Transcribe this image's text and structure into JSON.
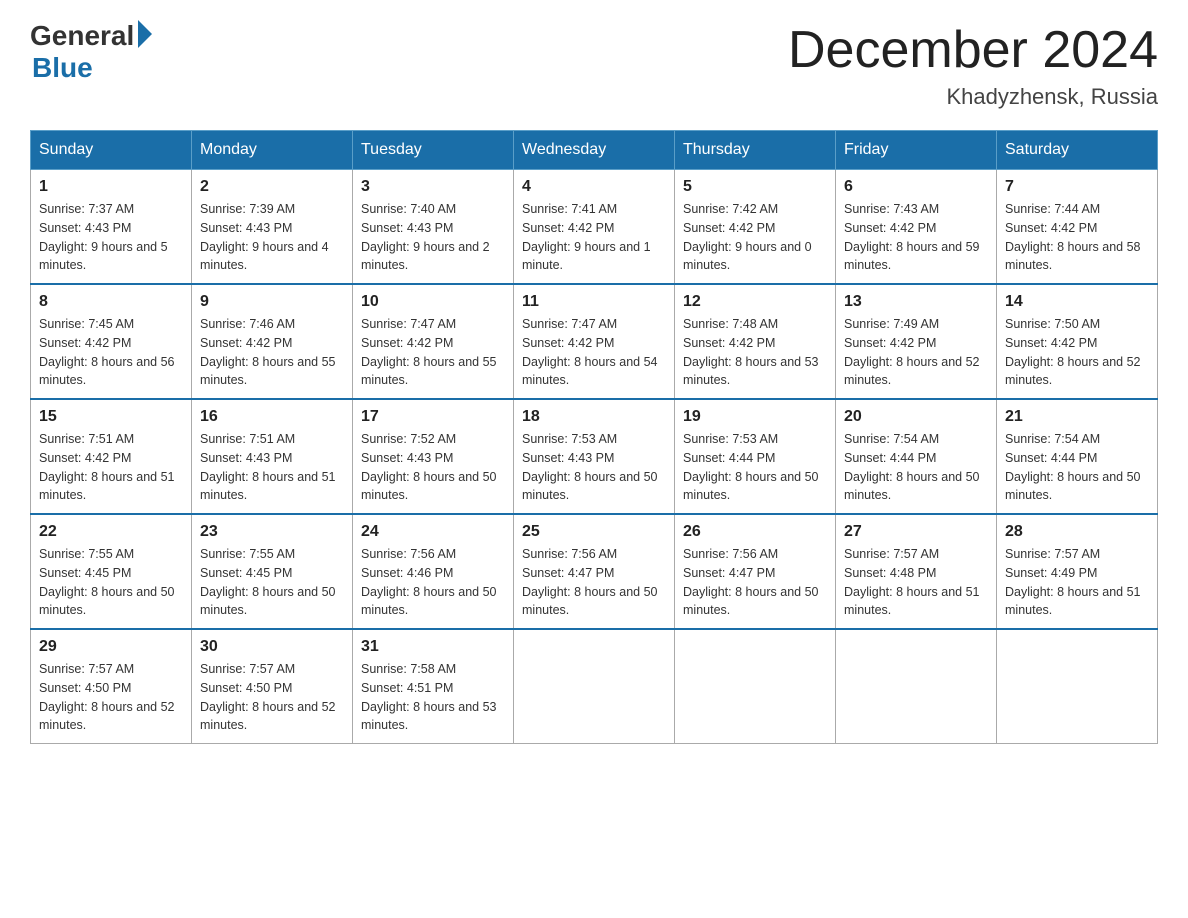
{
  "header": {
    "logo_general": "General",
    "logo_blue": "Blue",
    "title": "December 2024",
    "location": "Khadyzhensk, Russia"
  },
  "weekdays": [
    "Sunday",
    "Monday",
    "Tuesday",
    "Wednesday",
    "Thursday",
    "Friday",
    "Saturday"
  ],
  "weeks": [
    [
      {
        "day": "1",
        "sunrise": "7:37 AM",
        "sunset": "4:43 PM",
        "daylight": "9 hours and 5 minutes."
      },
      {
        "day": "2",
        "sunrise": "7:39 AM",
        "sunset": "4:43 PM",
        "daylight": "9 hours and 4 minutes."
      },
      {
        "day": "3",
        "sunrise": "7:40 AM",
        "sunset": "4:43 PM",
        "daylight": "9 hours and 2 minutes."
      },
      {
        "day": "4",
        "sunrise": "7:41 AM",
        "sunset": "4:42 PM",
        "daylight": "9 hours and 1 minute."
      },
      {
        "day": "5",
        "sunrise": "7:42 AM",
        "sunset": "4:42 PM",
        "daylight": "9 hours and 0 minutes."
      },
      {
        "day": "6",
        "sunrise": "7:43 AM",
        "sunset": "4:42 PM",
        "daylight": "8 hours and 59 minutes."
      },
      {
        "day": "7",
        "sunrise": "7:44 AM",
        "sunset": "4:42 PM",
        "daylight": "8 hours and 58 minutes."
      }
    ],
    [
      {
        "day": "8",
        "sunrise": "7:45 AM",
        "sunset": "4:42 PM",
        "daylight": "8 hours and 56 minutes."
      },
      {
        "day": "9",
        "sunrise": "7:46 AM",
        "sunset": "4:42 PM",
        "daylight": "8 hours and 55 minutes."
      },
      {
        "day": "10",
        "sunrise": "7:47 AM",
        "sunset": "4:42 PM",
        "daylight": "8 hours and 55 minutes."
      },
      {
        "day": "11",
        "sunrise": "7:47 AM",
        "sunset": "4:42 PM",
        "daylight": "8 hours and 54 minutes."
      },
      {
        "day": "12",
        "sunrise": "7:48 AM",
        "sunset": "4:42 PM",
        "daylight": "8 hours and 53 minutes."
      },
      {
        "day": "13",
        "sunrise": "7:49 AM",
        "sunset": "4:42 PM",
        "daylight": "8 hours and 52 minutes."
      },
      {
        "day": "14",
        "sunrise": "7:50 AM",
        "sunset": "4:42 PM",
        "daylight": "8 hours and 52 minutes."
      }
    ],
    [
      {
        "day": "15",
        "sunrise": "7:51 AM",
        "sunset": "4:42 PM",
        "daylight": "8 hours and 51 minutes."
      },
      {
        "day": "16",
        "sunrise": "7:51 AM",
        "sunset": "4:43 PM",
        "daylight": "8 hours and 51 minutes."
      },
      {
        "day": "17",
        "sunrise": "7:52 AM",
        "sunset": "4:43 PM",
        "daylight": "8 hours and 50 minutes."
      },
      {
        "day": "18",
        "sunrise": "7:53 AM",
        "sunset": "4:43 PM",
        "daylight": "8 hours and 50 minutes."
      },
      {
        "day": "19",
        "sunrise": "7:53 AM",
        "sunset": "4:44 PM",
        "daylight": "8 hours and 50 minutes."
      },
      {
        "day": "20",
        "sunrise": "7:54 AM",
        "sunset": "4:44 PM",
        "daylight": "8 hours and 50 minutes."
      },
      {
        "day": "21",
        "sunrise": "7:54 AM",
        "sunset": "4:44 PM",
        "daylight": "8 hours and 50 minutes."
      }
    ],
    [
      {
        "day": "22",
        "sunrise": "7:55 AM",
        "sunset": "4:45 PM",
        "daylight": "8 hours and 50 minutes."
      },
      {
        "day": "23",
        "sunrise": "7:55 AM",
        "sunset": "4:45 PM",
        "daylight": "8 hours and 50 minutes."
      },
      {
        "day": "24",
        "sunrise": "7:56 AM",
        "sunset": "4:46 PM",
        "daylight": "8 hours and 50 minutes."
      },
      {
        "day": "25",
        "sunrise": "7:56 AM",
        "sunset": "4:47 PM",
        "daylight": "8 hours and 50 minutes."
      },
      {
        "day": "26",
        "sunrise": "7:56 AM",
        "sunset": "4:47 PM",
        "daylight": "8 hours and 50 minutes."
      },
      {
        "day": "27",
        "sunrise": "7:57 AM",
        "sunset": "4:48 PM",
        "daylight": "8 hours and 51 minutes."
      },
      {
        "day": "28",
        "sunrise": "7:57 AM",
        "sunset": "4:49 PM",
        "daylight": "8 hours and 51 minutes."
      }
    ],
    [
      {
        "day": "29",
        "sunrise": "7:57 AM",
        "sunset": "4:50 PM",
        "daylight": "8 hours and 52 minutes."
      },
      {
        "day": "30",
        "sunrise": "7:57 AM",
        "sunset": "4:50 PM",
        "daylight": "8 hours and 52 minutes."
      },
      {
        "day": "31",
        "sunrise": "7:58 AM",
        "sunset": "4:51 PM",
        "daylight": "8 hours and 53 minutes."
      },
      null,
      null,
      null,
      null
    ]
  ]
}
